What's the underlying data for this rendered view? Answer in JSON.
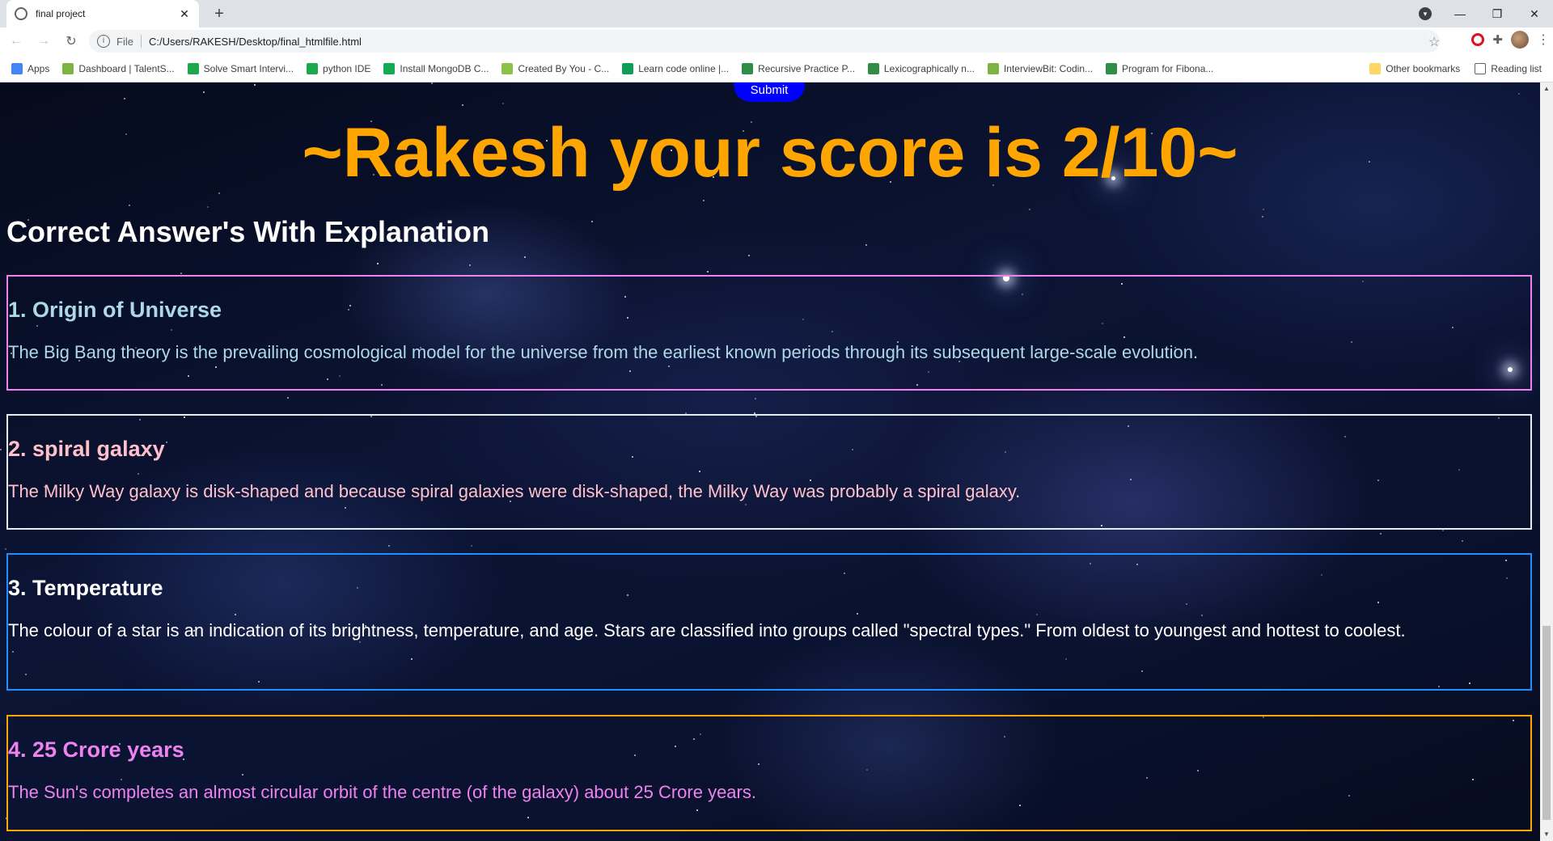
{
  "browser": {
    "tab_title": "final project",
    "new_tab": "+",
    "url_scheme": "File",
    "url": "C:/Users/RAKESH/Desktop/final_htmlfile.html",
    "bookmarks": [
      {
        "label": "Apps",
        "icon": "apps-grid-icon",
        "color": "#4285f4"
      },
      {
        "label": "Dashboard | TalentS...",
        "icon": "talent-icon",
        "color": "#7cb342"
      },
      {
        "label": "Solve Smart Intervi...",
        "icon": "hackerrank-icon",
        "color": "#1ba94c"
      },
      {
        "label": "python IDE",
        "icon": "python-ide-icon",
        "color": "#1ba94c"
      },
      {
        "label": "Install MongoDB C...",
        "icon": "mongodb-icon",
        "color": "#13aa52"
      },
      {
        "label": "Created By You - C...",
        "icon": "created-by-you-icon",
        "color": "#8bc34a"
      },
      {
        "label": "Learn code online |...",
        "icon": "play-icon",
        "color": "#0f9d58"
      },
      {
        "label": "Recursive Practice P...",
        "icon": "gfg-icon",
        "color": "#2f8d46"
      },
      {
        "label": "Lexicographically n...",
        "icon": "gfg-icon",
        "color": "#2f8d46"
      },
      {
        "label": "InterviewBit: Codin...",
        "icon": "interviewbit-icon",
        "color": "#7cb342"
      },
      {
        "label": "Program for Fibona...",
        "icon": "gfg-icon",
        "color": "#2f8d46"
      }
    ],
    "other_bookmarks": "Other bookmarks",
    "reading_list": "Reading list"
  },
  "page": {
    "submit_label": "Submit",
    "score_heading": "~Rakesh your score is 2/10~",
    "section_heading": "Correct Answer's With Explanation",
    "answers": [
      {
        "title": "1. Origin of Universe",
        "explanation": "The Big Bang theory is the prevailing cosmological model for the universe from the earliest known periods through its subsequent large-scale evolution.",
        "border": "#ee82ee",
        "color": "#add8e6"
      },
      {
        "title": "2. spiral galaxy",
        "explanation": "The Milky Way galaxy is disk-shaped and because spiral galaxies were disk-shaped, the Milky Way was probably a spiral galaxy.",
        "border": "#e0f0f0",
        "color": "#ffc0cb"
      },
      {
        "title": "3. Temperature",
        "explanation": "The colour of a star is an indication of its brightness, temperature, and age. Stars are classified into groups called \"spectral types.\" From oldest to youngest and hottest to coolest.",
        "border": "#1e90ff",
        "color": "#ffffff"
      },
      {
        "title": "4. 25 Crore years",
        "explanation": "The Sun's completes an almost circular orbit of the centre (of the galaxy) about 25 Crore years.",
        "border": "#ffa500",
        "color": "#ee82ee"
      }
    ],
    "colors": {
      "score": "#ffa500",
      "submit_bg": "#0000ff"
    }
  }
}
